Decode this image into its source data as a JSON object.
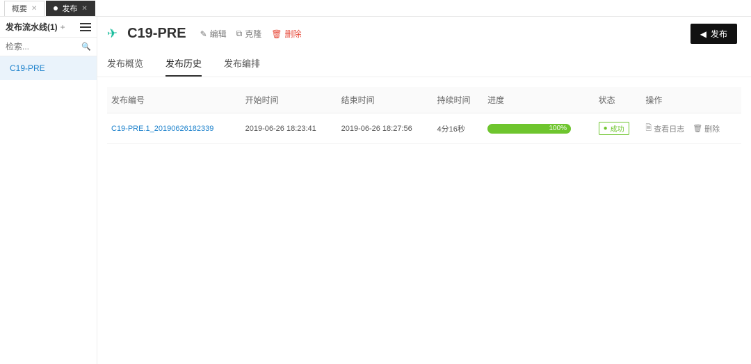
{
  "topTabs": [
    {
      "label": "概要",
      "active": false
    },
    {
      "label": "发布",
      "active": true
    }
  ],
  "sidebar": {
    "title": "发布流水线(1)",
    "search_placeholder": "检索...",
    "items": [
      {
        "label": "C19-PRE"
      }
    ]
  },
  "header": {
    "title": "C19-PRE",
    "edit_label": "编辑",
    "clone_label": "克隆",
    "delete_label": "删除",
    "publish_label": "发布"
  },
  "mainTabs": [
    {
      "label": "发布概览",
      "active": false
    },
    {
      "label": "发布历史",
      "active": true
    },
    {
      "label": "发布编排",
      "active": false
    }
  ],
  "table": {
    "columns": {
      "id": "发布编号",
      "start": "开始时间",
      "end": "结束时间",
      "duration": "持续时间",
      "progress": "进度",
      "status": "状态",
      "ops": "操作"
    },
    "ops": {
      "log": "查看日志",
      "del": "删除"
    },
    "rows": [
      {
        "id": "C19-PRE.1_20190626182339",
        "start": "2019-06-26 18:23:41",
        "end": "2019-06-26 18:27:56",
        "duration": "4分16秒",
        "progress_pct": "100%",
        "status": "成功"
      }
    ]
  }
}
